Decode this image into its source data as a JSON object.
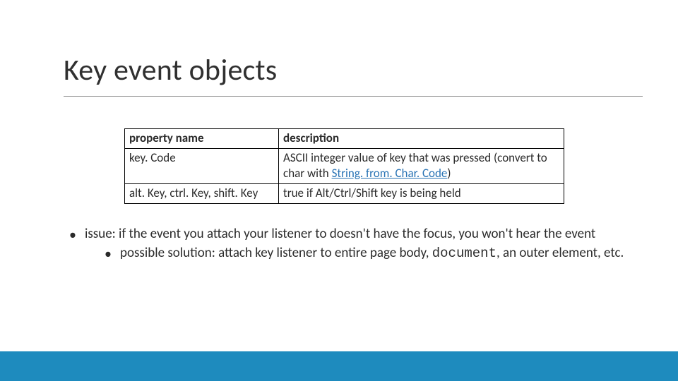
{
  "title": "Key event objects",
  "table": {
    "headers": {
      "prop": "property name",
      "desc": "description"
    },
    "rows": [
      {
        "prop": "key. Code",
        "desc_pre": "ASCII integer value of key that was pressed (convert to char with ",
        "desc_link": "String. from. Char. Code",
        "desc_post": ")"
      },
      {
        "prop": "alt. Key, ctrl. Key, shift. Key",
        "desc_pre": "true if Alt/Ctrl/Shift key is being held",
        "desc_link": "",
        "desc_post": ""
      }
    ]
  },
  "bullets": {
    "lvl1": "issue: if the event you attach your listener to doesn't have the focus, you won't hear the event",
    "lvl2_pre": "possible solution: attach key listener to entire page body, ",
    "lvl2_code": "document",
    "lvl2_post": ", an outer element, etc."
  }
}
